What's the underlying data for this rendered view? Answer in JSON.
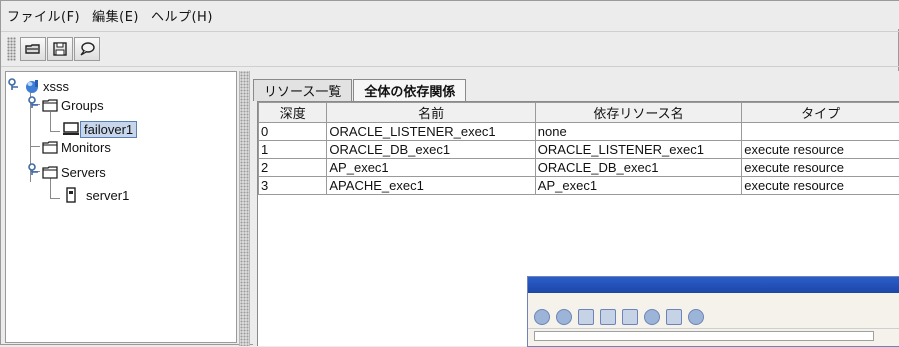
{
  "menubar": {
    "items": [
      {
        "label": "ファイル(F)"
      },
      {
        "label": "編集(E)"
      },
      {
        "label": "ヘルプ(H)"
      }
    ]
  },
  "toolbar": {
    "buttons": [
      {
        "icon": "folder-icon"
      },
      {
        "icon": "save-icon"
      },
      {
        "icon": "comment-icon"
      }
    ]
  },
  "tree": {
    "root": "xsss",
    "groups": "Groups",
    "failover": "failover1",
    "monitors": "Monitors",
    "servers": "Servers",
    "server": "server1"
  },
  "tabs": [
    {
      "label": "リソース一覧",
      "active": false
    },
    {
      "label": "全体の依存関係",
      "active": true
    }
  ],
  "table": {
    "columns": [
      "深度",
      "名前",
      "依存リソース名",
      "タイプ"
    ],
    "rows": [
      [
        "0",
        "ORACLE_LISTENER_exec1",
        "none",
        ""
      ],
      [
        "1",
        "ORACLE_DB_exec1",
        "ORACLE_LISTENER_exec1",
        "execute resource"
      ],
      [
        "2",
        "AP_exec1",
        "ORACLE_DB_exec1",
        "execute resource"
      ],
      [
        "3",
        "APACHE_exec1",
        "AP_exec1",
        "execute resource"
      ]
    ]
  },
  "colors": {
    "selection": "#c8d6ec",
    "thumb_titlebar": "#2c5ec9"
  }
}
